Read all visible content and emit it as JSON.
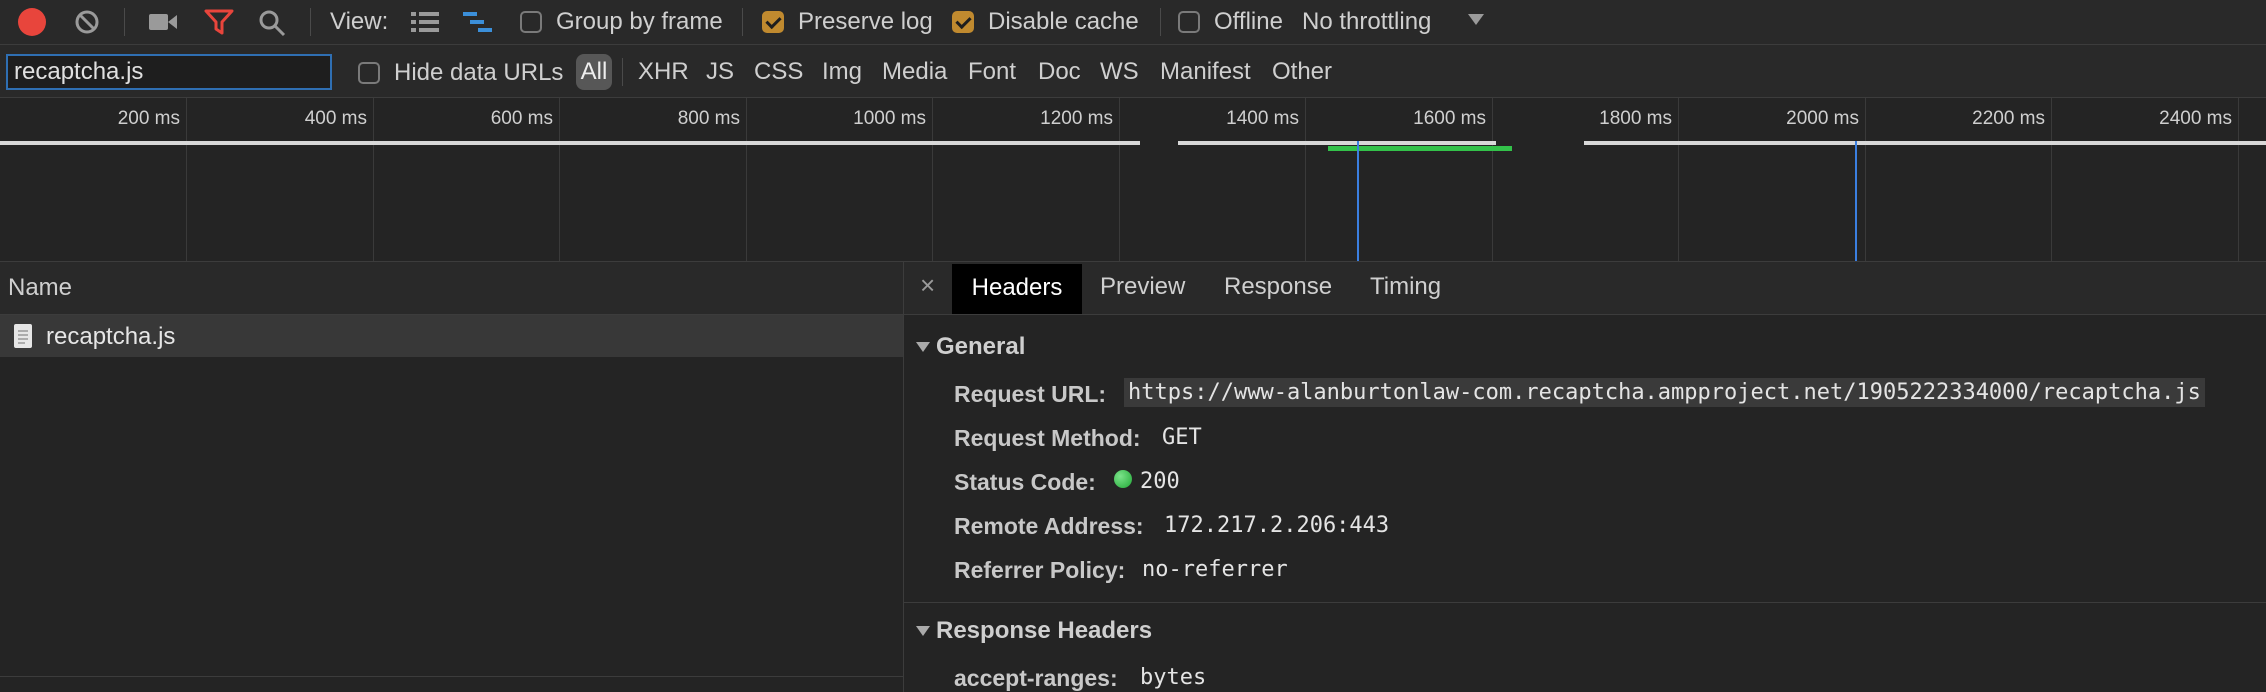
{
  "toolbar": {
    "view_label": "View:",
    "group_by_frame": "Group by frame",
    "preserve_log": "Preserve log",
    "disable_cache": "Disable cache",
    "offline": "Offline",
    "throttling": "No throttling",
    "group_by_frame_checked": false,
    "preserve_log_checked": true,
    "disable_cache_checked": true,
    "offline_checked": false
  },
  "filter": {
    "value": "recaptcha.js",
    "hide_data_urls": "Hide data URLs",
    "types": [
      "All",
      "XHR",
      "JS",
      "CSS",
      "Img",
      "Media",
      "Font",
      "Doc",
      "WS",
      "Manifest",
      "Other"
    ]
  },
  "timeline": {
    "ticks": [
      "200 ms",
      "400 ms",
      "600 ms",
      "800 ms",
      "1000 ms",
      "1200 ms",
      "1400 ms",
      "1600 ms",
      "1800 ms",
      "2000 ms",
      "2200 ms",
      "2400 ms"
    ]
  },
  "requests": {
    "column_name": "Name",
    "rows": [
      {
        "name": "recaptcha.js"
      }
    ]
  },
  "details": {
    "close": "×",
    "tabs": [
      "Headers",
      "Preview",
      "Response",
      "Timing"
    ],
    "general": {
      "title": "General",
      "request_url_key": "Request URL:",
      "request_url": "https://www-alanburtonlaw-com.recaptcha.ampproject.net/1905222334000/recaptcha.js",
      "request_method_key": "Request Method:",
      "request_method": "GET",
      "status_code_key": "Status Code:",
      "status_code": "200",
      "remote_address_key": "Remote Address:",
      "remote_address": "172.217.2.206:443",
      "referrer_policy_key": "Referrer Policy:",
      "referrer_policy": "no-referrer"
    },
    "response_headers": {
      "title": "Response Headers",
      "accept_ranges_key": "accept-ranges:",
      "accept_ranges": "bytes"
    }
  },
  "colors": {
    "record": "#e8453c",
    "filter_icon": "#e8453c",
    "checkbox_checked": "#c08a2f",
    "status_ok": "#33c24a",
    "selection_blue": "#2f6fb3"
  }
}
